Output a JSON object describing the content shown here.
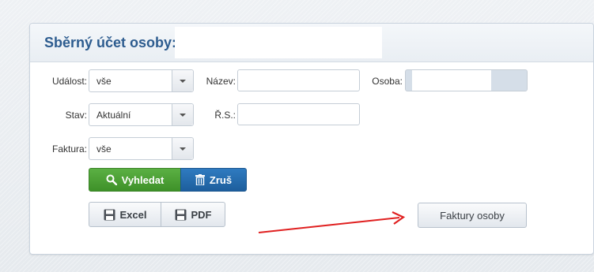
{
  "panel": {
    "title": "Sběrný účet osoby:"
  },
  "form": {
    "udalost": {
      "label": "Událost:",
      "value": "vše"
    },
    "nazev": {
      "label": "Název:",
      "value": ""
    },
    "osoba": {
      "label": "Osoba:",
      "value": ""
    },
    "stav": {
      "label": "Stav:",
      "value": "Aktuální"
    },
    "rs": {
      "label": "Ř.S.:",
      "value": ""
    },
    "faktura": {
      "label": "Faktura:",
      "value": "vše"
    }
  },
  "buttons": {
    "search": "Vyhledat",
    "cancel": "Zruš",
    "excel": "Excel",
    "pdf": "PDF",
    "faktury_osoby": "Faktury osoby"
  },
  "colors": {
    "title": "#2d5c8f",
    "search_button": "#4aa033",
    "cancel_button": "#2566a8",
    "annotation_arrow": "#e02020"
  },
  "icons": {
    "search": "magnifier-icon",
    "cancel": "trash-icon",
    "export": "floppy-disk-icon",
    "select": "chevron-down-icon"
  }
}
